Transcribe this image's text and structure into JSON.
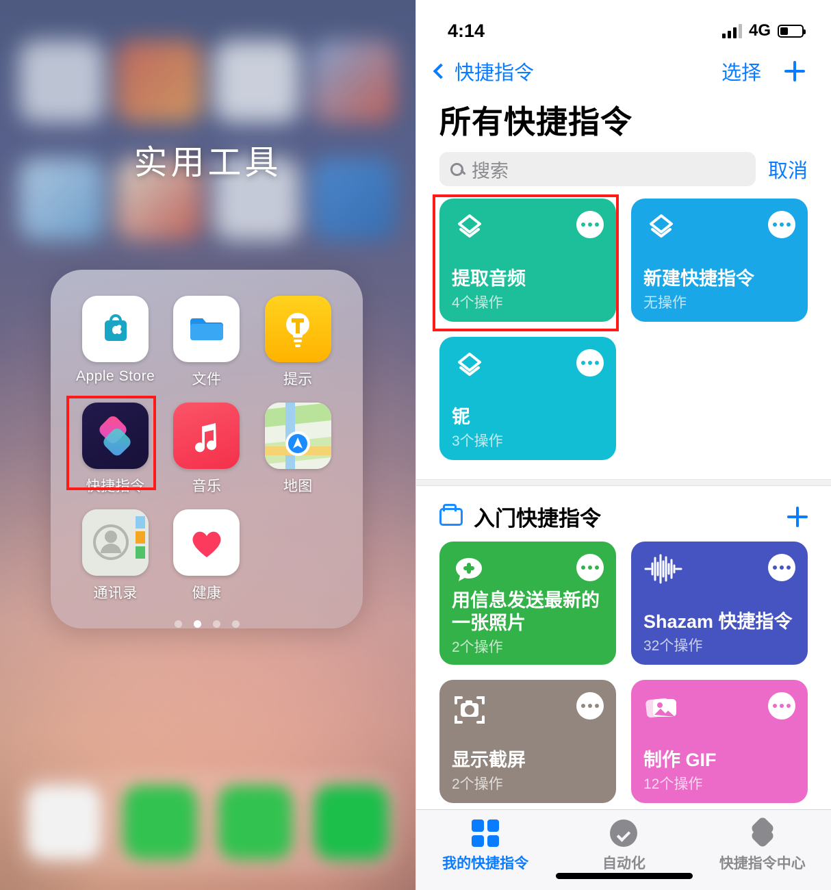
{
  "home_screen": {
    "folder_title": "实用工具",
    "apps": [
      {
        "name": "Apple Store",
        "icon": "apple-store-icon",
        "highlighted": false
      },
      {
        "name": "文件",
        "icon": "files-icon",
        "highlighted": false
      },
      {
        "name": "提示",
        "icon": "tips-icon",
        "highlighted": false
      },
      {
        "name": "快捷指令",
        "icon": "shortcuts-icon",
        "highlighted": true
      },
      {
        "name": "音乐",
        "icon": "music-icon",
        "highlighted": false
      },
      {
        "name": "地图",
        "icon": "maps-icon",
        "highlighted": false
      },
      {
        "name": "通讯录",
        "icon": "contacts-icon",
        "highlighted": false
      },
      {
        "name": "健康",
        "icon": "health-icon",
        "highlighted": false
      }
    ],
    "page_dots": {
      "count": 4,
      "active_index": 1
    }
  },
  "shortcuts_app": {
    "status_bar": {
      "time": "4:14",
      "network": "4G",
      "signal_icon": "signal-bars-icon",
      "battery_icon": "battery-icon"
    },
    "nav": {
      "back_label": "快捷指令",
      "back_icon": "chevron-left-icon",
      "select_label": "选择",
      "add_icon": "plus-icon"
    },
    "title": "所有快捷指令",
    "search": {
      "placeholder": "搜索",
      "value": "",
      "icon": "search-icon",
      "cancel_label": "取消"
    },
    "all_shortcuts": [
      {
        "title": "提取音频",
        "subtitle": "4个操作",
        "color": "#1cbf9a",
        "icon": "shortcut-layers-icon",
        "highlighted": true
      },
      {
        "title": "新建快捷指令",
        "subtitle": "无操作",
        "color": "#19a7e8",
        "icon": "shortcut-layers-icon",
        "highlighted": false
      },
      {
        "title": "铌",
        "subtitle": "3个操作",
        "color": "#12bed4",
        "icon": "shortcut-layers-icon",
        "highlighted": false
      }
    ],
    "section": {
      "folder_icon": "folder-icon",
      "title": "入门快捷指令",
      "add_icon": "plus-icon",
      "shortcuts": [
        {
          "title": "用信息发送最新的一张照片",
          "subtitle": "2个操作",
          "color": "#34b24a",
          "icon": "message-plus-icon"
        },
        {
          "title": "Shazam 快捷指令",
          "subtitle": "32个操作",
          "color": "#4554c0",
          "icon": "waveform-icon"
        },
        {
          "title": "显示截屏",
          "subtitle": "2个操作",
          "color": "#93867e",
          "icon": "camera-frame-icon"
        },
        {
          "title": "制作 GIF",
          "subtitle": "12个操作",
          "color": "#ec6bc8",
          "icon": "photos-icon"
        }
      ]
    },
    "tabs": [
      {
        "label": "我的快捷指令",
        "icon": "grid-icon",
        "active": true
      },
      {
        "label": "自动化",
        "icon": "automation-check-icon",
        "active": false
      },
      {
        "label": "快捷指令中心",
        "icon": "gallery-layers-icon",
        "active": false
      }
    ],
    "accent_color": "#0a7cff",
    "highlight_color": "#ff1a1a"
  }
}
